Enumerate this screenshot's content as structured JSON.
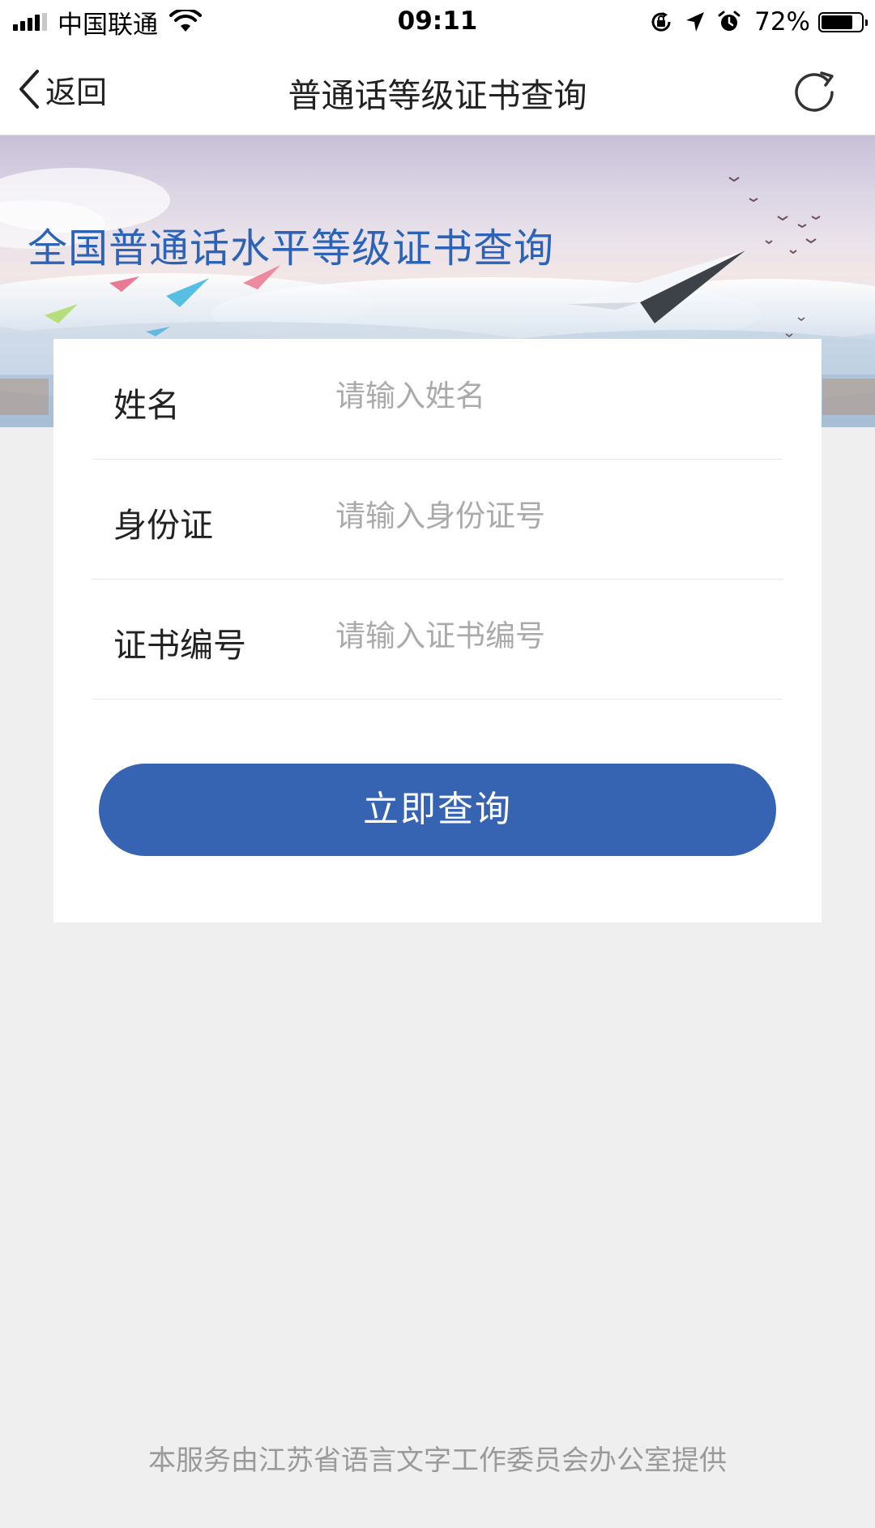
{
  "status_bar": {
    "carrier": "中国联通",
    "time": "09:11",
    "battery_percent": "72%",
    "battery_level": 0.72,
    "signal_bars": 4,
    "signal_bars_total": 5,
    "icons": [
      "signal-icon",
      "wifi-icon",
      "rotation-lock-icon",
      "location-arrow-icon",
      "alarm-clock-icon",
      "battery-icon"
    ]
  },
  "nav": {
    "back_label": "返回",
    "title": "普通话等级证书查询",
    "back_icon": "chevron-left-icon",
    "refresh_icon": "refresh-icon"
  },
  "banner": {
    "title": "全国普通话水平等级证书查询"
  },
  "form": {
    "fields": [
      {
        "label": "姓名",
        "placeholder": "请输入姓名",
        "value": ""
      },
      {
        "label": "身份证",
        "placeholder": "请输入身份证号",
        "value": ""
      },
      {
        "label": "证书编号",
        "placeholder": "请输入证书编号",
        "value": ""
      }
    ],
    "submit_label": "立即查询"
  },
  "footer": {
    "text": "本服务由江苏省语言文字工作委员会办公室提供"
  },
  "colors": {
    "accent": "#3664b3",
    "banner_title": "#2d63b6",
    "page_background": "#efefef",
    "placeholder": "#aaaaaa",
    "footer_text": "#9a9a9a"
  }
}
